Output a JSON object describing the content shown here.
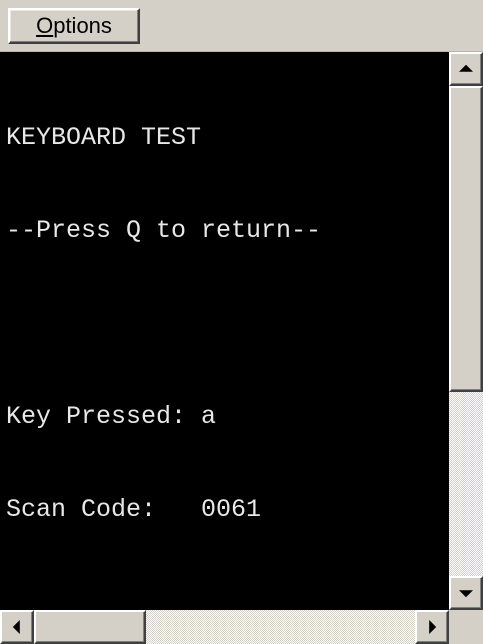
{
  "menubar": {
    "options_accel": "O",
    "options_rest": "ptions"
  },
  "terminal": {
    "lines": [
      "KEYBOARD TEST",
      "--Press Q to return--",
      "",
      "Key Pressed: a",
      "Scan Code:   0061"
    ]
  },
  "icons": {
    "scroll_up": "scroll-up-arrow-icon",
    "scroll_down": "scroll-down-arrow-icon",
    "scroll_left": "scroll-left-arrow-icon",
    "scroll_right": "scroll-right-arrow-icon"
  },
  "colors": {
    "terminal_background": "#000000",
    "terminal_text": "#e8e8e8",
    "chrome": "#d4d0c8"
  }
}
